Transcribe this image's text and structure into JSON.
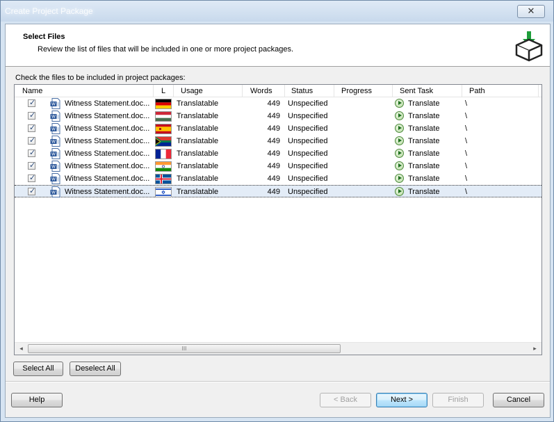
{
  "window": {
    "title": "Create Project Package",
    "close_glyph": "✕"
  },
  "header": {
    "title": "Select Files",
    "subtitle": "Review the list of files that will be included in one or more project packages."
  },
  "instruction": "Check the files to be included in project packages:",
  "columns": {
    "name": "Name",
    "lang": "L",
    "usage": "Usage",
    "words": "Words",
    "status": "Status",
    "progress": "Progress",
    "sent_task": "Sent Task",
    "path": "Path"
  },
  "files": [
    {
      "checked": true,
      "name": "Witness Statement.doc...",
      "flag": "germany",
      "usage": "Translatable",
      "words": "449",
      "status": "Unspecified",
      "progress": "",
      "sent_task": "Translate",
      "path": "\\"
    },
    {
      "checked": true,
      "name": "Witness Statement.doc...",
      "flag": "hungary",
      "usage": "Translatable",
      "words": "449",
      "status": "Unspecified",
      "progress": "",
      "sent_task": "Translate",
      "path": "\\"
    },
    {
      "checked": true,
      "name": "Witness Statement.doc...",
      "flag": "spain",
      "usage": "Translatable",
      "words": "449",
      "status": "Unspecified",
      "progress": "",
      "sent_task": "Translate",
      "path": "\\"
    },
    {
      "checked": true,
      "name": "Witness Statement.doc...",
      "flag": "south-africa",
      "usage": "Translatable",
      "words": "449",
      "status": "Unspecified",
      "progress": "",
      "sent_task": "Translate",
      "path": "\\"
    },
    {
      "checked": true,
      "name": "Witness Statement.doc...",
      "flag": "france",
      "usage": "Translatable",
      "words": "449",
      "status": "Unspecified",
      "progress": "",
      "sent_task": "Translate",
      "path": "\\"
    },
    {
      "checked": true,
      "name": "Witness Statement.doc...",
      "flag": "india",
      "usage": "Translatable",
      "words": "449",
      "status": "Unspecified",
      "progress": "",
      "sent_task": "Translate",
      "path": "\\"
    },
    {
      "checked": true,
      "name": "Witness Statement.doc...",
      "flag": "iceland",
      "usage": "Translatable",
      "words": "449",
      "status": "Unspecified",
      "progress": "",
      "sent_task": "Translate",
      "path": "\\"
    },
    {
      "checked": true,
      "name": "Witness Statement.doc...",
      "flag": "israel",
      "usage": "Translatable",
      "words": "449",
      "status": "Unspecified",
      "progress": "",
      "sent_task": "Translate",
      "path": "\\",
      "selected": true
    }
  ],
  "scrollbar": {
    "left_arrow": "◂",
    "right_arrow": "▸",
    "grip": "III"
  },
  "buttons": {
    "select_all": "Select All",
    "deselect_all": "Deselect All",
    "help": "Help",
    "back": "< Back",
    "next": "Next >",
    "finish": "Finish",
    "cancel": "Cancel"
  },
  "colors": {
    "accent": "#3c7fb1",
    "selection": "#e3ecf7",
    "task_green": "#1f6e1f"
  }
}
